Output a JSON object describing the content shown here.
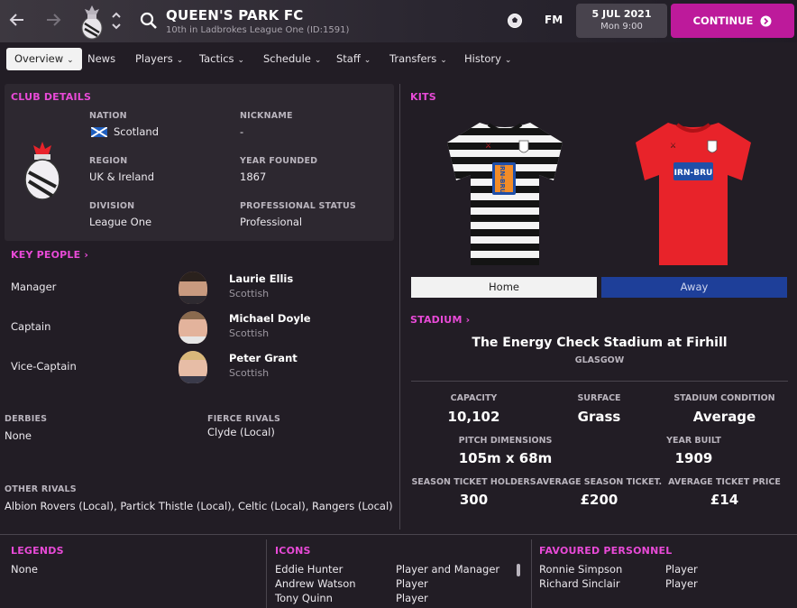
{
  "header": {
    "club_name": "QUEEN'S PARK FC",
    "club_sub": "10th in Ladbrokes League One (ID:1591)",
    "fm_logo": "FM",
    "date": "5 JUL 2021",
    "time": "Mon 9:00",
    "continue_label": "CONTINUE",
    "icons": [
      "back-arrow-icon",
      "forward-arrow-icon",
      "club-badge-icon",
      "up-down-chevron-icon",
      "search-icon",
      "football-icon",
      "continue-arrow-icon"
    ]
  },
  "tabs": [
    {
      "label": "Overview",
      "active": true
    },
    {
      "label": "News"
    },
    {
      "label": "Players"
    },
    {
      "label": "Tactics"
    },
    {
      "label": "Schedule"
    },
    {
      "label": "Staff"
    },
    {
      "label": "Transfers"
    },
    {
      "label": "History"
    }
  ],
  "club_details": {
    "title": "CLUB DETAILS",
    "nation_label": "NATION",
    "nation": "Scotland",
    "nickname_label": "NICKNAME",
    "nickname": "-",
    "region_label": "REGION",
    "region": "UK & Ireland",
    "year_founded_label": "YEAR FOUNDED",
    "year_founded": "1867",
    "division_label": "DIVISION",
    "division": "League One",
    "status_label": "PROFESSIONAL STATUS",
    "status": "Professional"
  },
  "key_people": {
    "title": "KEY PEOPLE",
    "rows": [
      {
        "role": "Manager",
        "name": "Laurie Ellis",
        "nationality": "Scottish"
      },
      {
        "role": "Captain",
        "name": "Michael Doyle",
        "nationality": "Scottish"
      },
      {
        "role": "Vice-Captain",
        "name": "Peter Grant",
        "nationality": "Scottish"
      }
    ]
  },
  "rivals": {
    "derbies_label": "DERBIES",
    "derbies": "None",
    "fierce_label": "FIERCE RIVALS",
    "fierce": "Clyde (Local)",
    "other_label": "OTHER RIVALS",
    "other": "Albion Rovers (Local), Partick Thistle (Local), Celtic (Local), Rangers (Local)"
  },
  "kits": {
    "title": "KITS",
    "sponsor": "IRN-BRU",
    "home_label": "Home",
    "away_label": "Away"
  },
  "stadium": {
    "title": "STADIUM",
    "name": "The Energy Check Stadium at Firhill",
    "city": "GLASGOW",
    "capacity_label": "CAPACITY",
    "capacity": "10,102",
    "surface_label": "SURFACE",
    "surface": "Grass",
    "condition_label": "STADIUM CONDITION",
    "condition": "Average",
    "pitch_label": "PITCH DIMENSIONS",
    "pitch": "105m x 68m",
    "built_label": "YEAR BUILT",
    "built": "1909",
    "season_label": "SEASON TICKET HOLDERS",
    "season": "300",
    "avg_season_label": "AVERAGE SEASON TICKET...",
    "avg_season": "£200",
    "avg_ticket_label": "AVERAGE TICKET PRICE",
    "avg_ticket": "£14"
  },
  "legends": {
    "title": "LEGENDS",
    "value": "None"
  },
  "icons_panel": {
    "title": "ICONS",
    "rows": [
      {
        "name": "Eddie Hunter",
        "role": "Player and Manager"
      },
      {
        "name": "Andrew Watson",
        "role": "Player"
      },
      {
        "name": "Tony Quinn",
        "role": "Player"
      }
    ]
  },
  "favoured": {
    "title": "FAVOURED PERSONNEL",
    "rows": [
      {
        "name": "Ronnie Simpson",
        "role": "Player"
      },
      {
        "name": "Richard Sinclair",
        "role": "Player"
      }
    ]
  },
  "colors": {
    "accent": "#e84ad7",
    "continue": "#bd1a9b",
    "away_tab": "#1e3f99",
    "home_tab": "#f2f2f2",
    "away_kit": "#e8232a"
  }
}
